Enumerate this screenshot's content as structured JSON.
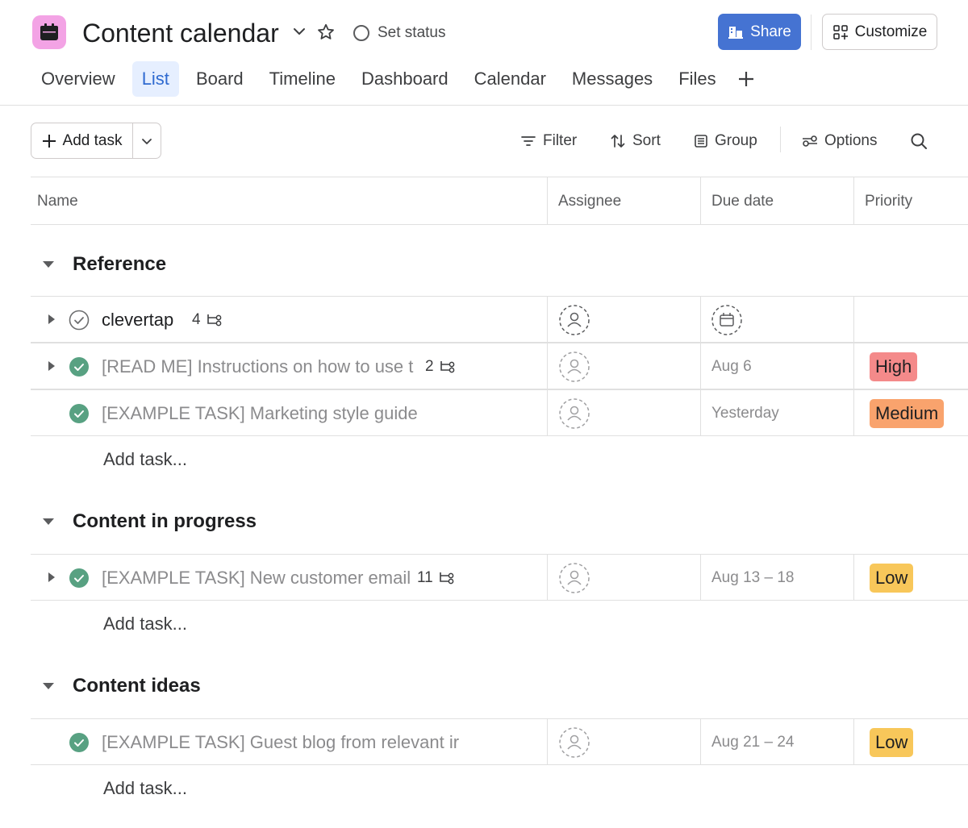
{
  "header": {
    "title": "Content calendar",
    "set_status": "Set status",
    "share_label": "Share",
    "customize_label": "Customize",
    "colors": {
      "project_icon": "#f3a3e5",
      "share_bg": "#4573d2",
      "active_tab": "#2f6ad0"
    }
  },
  "tabs": [
    {
      "label": "Overview"
    },
    {
      "label": "List",
      "active": true
    },
    {
      "label": "Board"
    },
    {
      "label": "Timeline"
    },
    {
      "label": "Dashboard"
    },
    {
      "label": "Calendar"
    },
    {
      "label": "Messages"
    },
    {
      "label": "Files"
    }
  ],
  "toolbar": {
    "add_task": "Add task",
    "filter": "Filter",
    "sort": "Sort",
    "group": "Group",
    "options": "Options"
  },
  "columns": {
    "name": "Name",
    "assignee": "Assignee",
    "due_date": "Due date",
    "priority": "Priority"
  },
  "add_task_row": "Add task...",
  "sections": [
    {
      "title": "Reference",
      "tasks": [
        {
          "name": "clevertap",
          "subtasks": "4",
          "completed": false,
          "due": "",
          "priority": ""
        },
        {
          "name": "[READ ME] Instructions on how to use t",
          "subtasks": "2",
          "completed": true,
          "due": "Aug 6",
          "priority": "High"
        },
        {
          "name": "[EXAMPLE TASK] Marketing style guide",
          "subtasks": "",
          "completed": true,
          "due": "Yesterday",
          "priority": "Medium"
        }
      ]
    },
    {
      "title": "Content in progress",
      "tasks": [
        {
          "name": "[EXAMPLE TASK] New customer email",
          "subtasks": "11",
          "completed": true,
          "due": "Aug 13 – 18",
          "priority": "Low"
        }
      ]
    },
    {
      "title": "Content ideas",
      "tasks": [
        {
          "name": "[EXAMPLE TASK] Guest blog from relevant ir",
          "subtasks": "",
          "completed": true,
          "due": "Aug 21 – 24",
          "priority": "Low"
        }
      ]
    }
  ],
  "priority_colors": {
    "High": "#f48a8a",
    "Medium": "#f9a36d",
    "Low": "#f8c75a"
  },
  "icons": [
    "calendar-icon",
    "chevron-down-icon",
    "star-icon",
    "status-circle-icon",
    "share-icon",
    "customize-icon",
    "plus-icon",
    "filter-icon",
    "sort-icon",
    "group-icon",
    "options-icon",
    "search-icon",
    "caret-down-icon",
    "caret-right-icon",
    "check-circle-icon",
    "subtask-icon",
    "avatar-placeholder-icon",
    "due-date-icon"
  ]
}
